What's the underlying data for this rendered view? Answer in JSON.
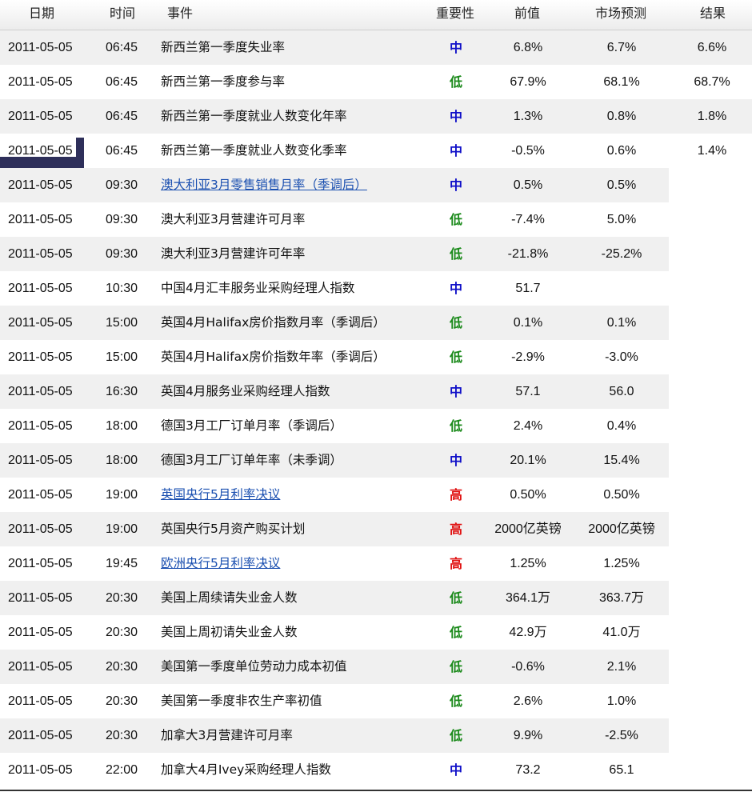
{
  "colors": {
    "high": "#e01010",
    "medium": "#1010c8",
    "low": "#1b8a1b",
    "link": "#1a4fb0"
  },
  "headers": {
    "date": "日期",
    "time": "时间",
    "event": "事件",
    "importance": "重要性",
    "previous": "前值",
    "forecast": "市场预测",
    "result": "结果"
  },
  "rows": [
    {
      "date": "2011-05-05",
      "time": "06:45",
      "event": "新西兰第一季度失业率",
      "importance": "中",
      "level": "medium",
      "previous": "6.8%",
      "forecast": "6.7%",
      "result": "6.6%",
      "link": false
    },
    {
      "date": "2011-05-05",
      "time": "06:45",
      "event": "新西兰第一季度参与率",
      "importance": "低",
      "level": "low",
      "previous": "67.9%",
      "forecast": "68.1%",
      "result": "68.7%",
      "link": false
    },
    {
      "date": "2011-05-05",
      "time": "06:45",
      "event": "新西兰第一季度就业人数变化年率",
      "importance": "中",
      "level": "medium",
      "previous": "1.3%",
      "forecast": "0.8%",
      "result": "1.8%",
      "link": false
    },
    {
      "date": "2011-05-05",
      "time": "06:45",
      "event": "新西兰第一季度就业人数变化季率",
      "importance": "中",
      "level": "medium",
      "previous": "-0.5%",
      "forecast": "0.6%",
      "result": "1.4%",
      "link": false
    },
    {
      "date": "2011-05-05",
      "time": "09:30",
      "event": "澳大利亚3月零售销售月率（季调后）",
      "importance": "中",
      "level": "medium",
      "previous": "0.5%",
      "forecast": "0.5%",
      "result": "",
      "link": true
    },
    {
      "date": "2011-05-05",
      "time": "09:30",
      "event": "澳大利亚3月营建许可月率",
      "importance": "低",
      "level": "low",
      "previous": "-7.4%",
      "forecast": "5.0%",
      "result": "",
      "link": false
    },
    {
      "date": "2011-05-05",
      "time": "09:30",
      "event": "澳大利亚3月营建许可年率",
      "importance": "低",
      "level": "low",
      "previous": "-21.8%",
      "forecast": "-25.2%",
      "result": "",
      "link": false
    },
    {
      "date": "2011-05-05",
      "time": "10:30",
      "event": "中国4月汇丰服务业采购经理人指数",
      "importance": "中",
      "level": "medium",
      "previous": "51.7",
      "forecast": "",
      "result": "",
      "link": false
    },
    {
      "date": "2011-05-05",
      "time": "15:00",
      "event": "英国4月Halifax房价指数月率（季调后）",
      "importance": "低",
      "level": "low",
      "previous": "0.1%",
      "forecast": "0.1%",
      "result": "",
      "link": false
    },
    {
      "date": "2011-05-05",
      "time": "15:00",
      "event": "英国4月Halifax房价指数年率（季调后）",
      "importance": "低",
      "level": "low",
      "previous": "-2.9%",
      "forecast": "-3.0%",
      "result": "",
      "link": false
    },
    {
      "date": "2011-05-05",
      "time": "16:30",
      "event": "英国4月服务业采购经理人指数",
      "importance": "中",
      "level": "medium",
      "previous": "57.1",
      "forecast": "56.0",
      "result": "",
      "link": false
    },
    {
      "date": "2011-05-05",
      "time": "18:00",
      "event": "德国3月工厂订单月率（季调后）",
      "importance": "低",
      "level": "low",
      "previous": "2.4%",
      "forecast": "0.4%",
      "result": "",
      "link": false
    },
    {
      "date": "2011-05-05",
      "time": "18:00",
      "event": "德国3月工厂订单年率（未季调）",
      "importance": "中",
      "level": "medium",
      "previous": "20.1%",
      "forecast": "15.4%",
      "result": "",
      "link": false
    },
    {
      "date": "2011-05-05",
      "time": "19:00",
      "event": "英国央行5月利率决议",
      "importance": "高",
      "level": "high",
      "previous": "0.50%",
      "forecast": "0.50%",
      "result": "",
      "link": true
    },
    {
      "date": "2011-05-05",
      "time": "19:00",
      "event": "英国央行5月资产购买计划",
      "importance": "高",
      "level": "high",
      "previous": "2000亿英镑",
      "forecast": "2000亿英镑",
      "result": "",
      "link": false
    },
    {
      "date": "2011-05-05",
      "time": "19:45",
      "event": "欧洲央行5月利率决议",
      "importance": "高",
      "level": "high",
      "previous": "1.25%",
      "forecast": "1.25%",
      "result": "",
      "link": true
    },
    {
      "date": "2011-05-05",
      "time": "20:30",
      "event": "美国上周续请失业金人数",
      "importance": "低",
      "level": "low",
      "previous": "364.1万",
      "forecast": "363.7万",
      "result": "",
      "link": false
    },
    {
      "date": "2011-05-05",
      "time": "20:30",
      "event": "美国上周初请失业金人数",
      "importance": "低",
      "level": "low",
      "previous": "42.9万",
      "forecast": "41.0万",
      "result": "",
      "link": false
    },
    {
      "date": "2011-05-05",
      "time": "20:30",
      "event": "美国第一季度单位劳动力成本初值",
      "importance": "低",
      "level": "low",
      "previous": "-0.6%",
      "forecast": "2.1%",
      "result": "",
      "link": false
    },
    {
      "date": "2011-05-05",
      "time": "20:30",
      "event": "美国第一季度非农生产率初值",
      "importance": "低",
      "level": "low",
      "previous": "2.6%",
      "forecast": "1.0%",
      "result": "",
      "link": false
    },
    {
      "date": "2011-05-05",
      "time": "20:30",
      "event": "加拿大3月营建许可月率",
      "importance": "低",
      "level": "low",
      "previous": "9.9%",
      "forecast": "-2.5%",
      "result": "",
      "link": false
    },
    {
      "date": "2011-05-05",
      "time": "22:00",
      "event": "加拿大4月Ivey采购经理人指数",
      "importance": "中",
      "level": "medium",
      "previous": "73.2",
      "forecast": "65.1",
      "result": "",
      "link": false
    }
  ]
}
